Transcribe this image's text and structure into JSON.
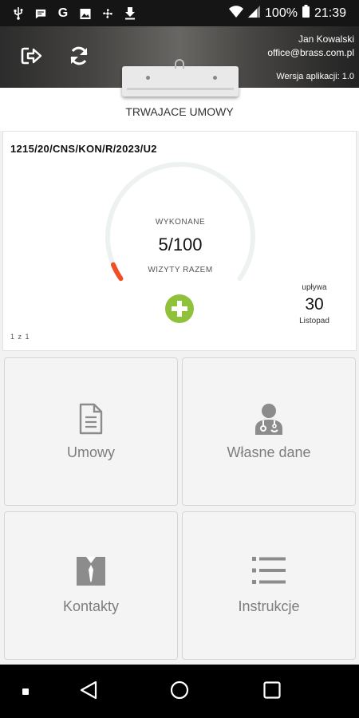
{
  "status_bar": {
    "battery": "100%",
    "time": "21:39",
    "icons": [
      "usb-icon",
      "message-icon",
      "google-icon",
      "photo-icon",
      "fan-icon",
      "download-icon",
      "wifi-icon",
      "signal-icon",
      "battery-icon"
    ]
  },
  "header": {
    "user_name": "Jan Kowalski",
    "user_email": "office@brass.com.pl",
    "version": "Wersja aplikacji: 1.0",
    "icons": [
      "logout-icon",
      "refresh-icon"
    ]
  },
  "section": {
    "title": "TRWAJACE UMOWY"
  },
  "contract": {
    "id": "1215/20/CNS/KON/R/2023/U2",
    "completed_label": "WYKONANE",
    "visits_value": "5/100",
    "visits_label": "WIZYTY RAZEM",
    "progress_fraction": 0.05,
    "expires_label": "upływa",
    "expires_day": "30",
    "expires_month": "Listopad",
    "pager": "1 z 1",
    "colors": {
      "track": "#eef1f1",
      "progress": "#f04e23",
      "add": "#8fc13a"
    }
  },
  "tiles": [
    {
      "label": "Umowy",
      "icon": "document-icon"
    },
    {
      "label": "Własne dane",
      "icon": "doctor-icon"
    },
    {
      "label": "Kontakty",
      "icon": "contact-card-icon"
    },
    {
      "label": "Instrukcje",
      "icon": "list-icon"
    }
  ],
  "nav": {
    "icons": [
      "recent-dot-icon",
      "back-icon",
      "home-icon",
      "overview-icon"
    ]
  }
}
